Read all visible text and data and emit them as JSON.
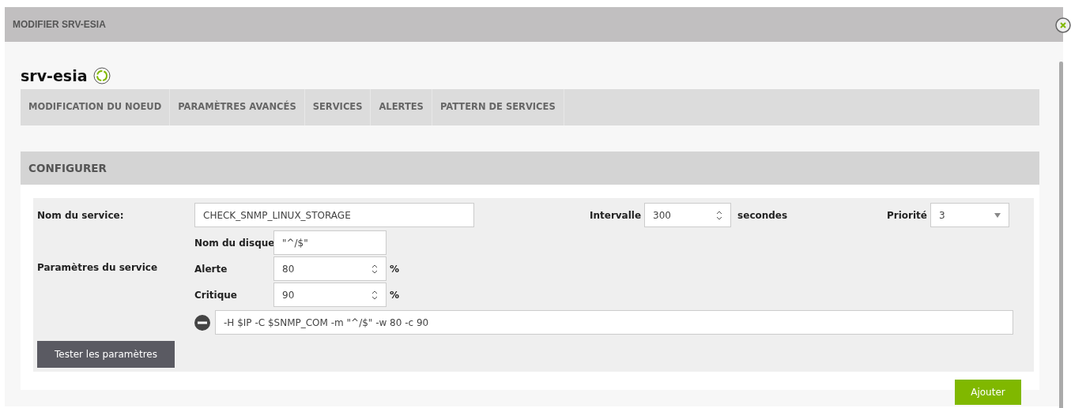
{
  "modal": {
    "title": "MODIFIER SRV-ESIA"
  },
  "node": {
    "name": "srv-esia"
  },
  "tabs": [
    {
      "label": "MODIFICATION DU NOEUD"
    },
    {
      "label": "PARAMÈTRES AVANCÉS"
    },
    {
      "label": "SERVICES"
    },
    {
      "label": "ALERTES"
    },
    {
      "label": "PATTERN DE SERVICES"
    }
  ],
  "section": {
    "title": "CONFIGURER"
  },
  "form": {
    "service_name": {
      "label": "Nom du service:",
      "value": "CHECK_SNMP_LINUX_STORAGE"
    },
    "interval": {
      "label": "Intervalle",
      "value": "300",
      "unit": "secondes"
    },
    "priority": {
      "label": "Priorité",
      "value": "3"
    },
    "params_label": "Paramètres du service",
    "params": [
      {
        "kind": "text",
        "label": "Nom du disque",
        "value": "\"^/$\""
      },
      {
        "kind": "number",
        "label": "Alerte",
        "value": "80",
        "unit": "%"
      },
      {
        "kind": "number",
        "label": "Critique",
        "value": "90",
        "unit": "%"
      }
    ],
    "command": {
      "value": "-H $IP -C $SNMP_COM -m \"^/$\" -w 80 -c 90"
    },
    "test_button": "Tester les paramètres"
  },
  "add_button": "Ajouter"
}
